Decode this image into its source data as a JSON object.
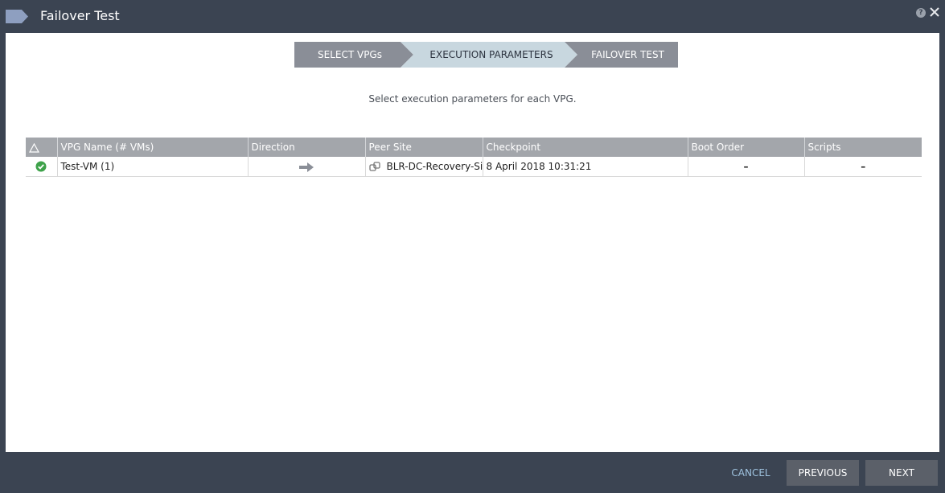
{
  "window": {
    "title": "Failover Test"
  },
  "wizard": {
    "steps": [
      {
        "label": "SELECT VPGs"
      },
      {
        "label": "EXECUTION PARAMETERS"
      },
      {
        "label": "FAILOVER TEST"
      }
    ],
    "active_step": 1
  },
  "instruction": "Select execution parameters for each VPG.",
  "table": {
    "columns": [
      "VPG Name (# VMs)",
      "Direction",
      "Peer Site",
      "Checkpoint",
      "Boot Order",
      "Scripts"
    ],
    "rows": [
      {
        "status": "ok",
        "vpg_name": "Test-VM (1)",
        "direction": "→",
        "peer_site": "BLR-DC-Recovery-Site",
        "checkpoint": "8 April 2018 10:31:21",
        "boot_order": "–",
        "scripts": "–"
      }
    ]
  },
  "footer": {
    "cancel": "CANCEL",
    "previous": "PREVIOUS",
    "next": "NEXT"
  },
  "colors": {
    "title_bar": "#3b4452",
    "active_step": "#c8d7df",
    "inactive_step": "#8a8e97",
    "table_header": "#a3a6ab",
    "status_ok": "#3ea24a",
    "checkpoint_text": "#1d3d74",
    "cancel_text": "#9fc3df"
  },
  "icons": {
    "logo": "zerto-tag-icon",
    "help": "help-icon",
    "close": "close-icon",
    "sort_warning": "warning-triangle-icon",
    "status": "check-circle-icon",
    "direction": "arrow-right-icon",
    "peer_site": "site-link-icon"
  }
}
